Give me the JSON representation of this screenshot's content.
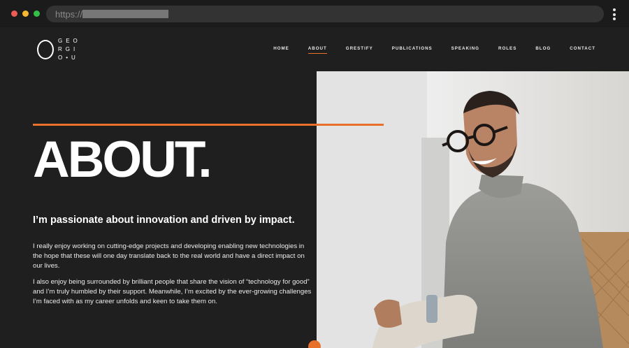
{
  "browser": {
    "url_prefix": "https://"
  },
  "logo": {
    "row1": "GEO",
    "row2": "RGI",
    "row3": "O•U"
  },
  "nav": {
    "items": [
      "HOME",
      "ABOUT",
      "GRESTIFY",
      "PUBLICATIONS",
      "SPEAKING",
      "ROLES",
      "BLOG",
      "CONTACT"
    ],
    "active": "ABOUT"
  },
  "hero": {
    "title": "ABOUT.",
    "subtitle": "I’m passionate about innovation and driven by impact.",
    "paragraph1": "I really enjoy working on cutting-edge projects and developing enabling new technologies in the hope that these will one day translate back to the real world and have a direct impact on our lives.",
    "paragraph2": "I also enjoy being surrounded by brilliant people that share the vision of “technology for good” and I’m truly humbled by their support. Meanwhile, I’m excited by the ever-growing challenges I’m faced with as my career unfolds and keen to take them on."
  },
  "colors": {
    "accent": "#e8702a",
    "background": "#1f1f1f"
  }
}
